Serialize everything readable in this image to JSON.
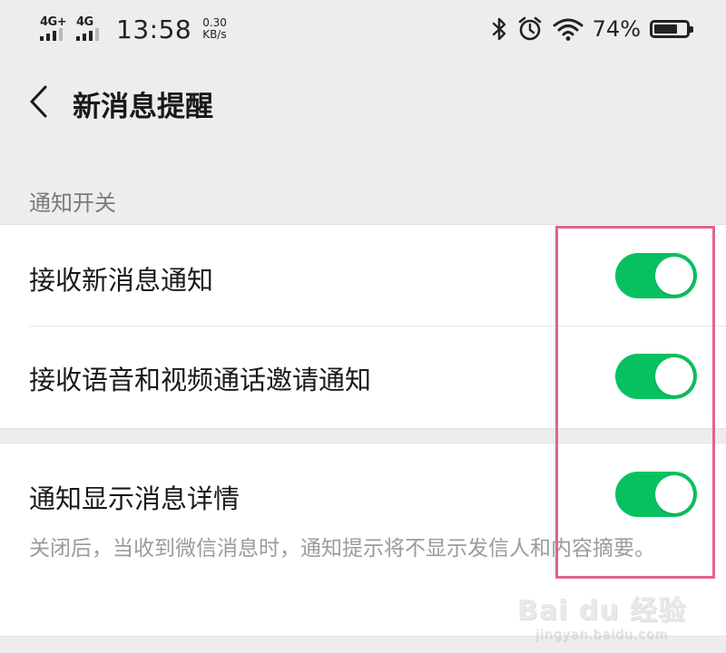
{
  "status_bar": {
    "network_1": "4G+",
    "network_2": "4G",
    "time": "13:58",
    "speed_value": "0.30",
    "speed_unit": "KB/s",
    "battery_percent_text": "74%",
    "battery_level": 0.74,
    "icons": [
      "bluetooth-icon",
      "alarm-icon",
      "wifi-icon",
      "battery-icon"
    ]
  },
  "nav": {
    "back_icon": "chevron-left-icon",
    "title": "新消息提醒"
  },
  "section": {
    "header": "通知开关"
  },
  "settings": [
    {
      "label": "接收新消息通知",
      "enabled": true
    },
    {
      "label": "接收语音和视频通话邀请通知",
      "enabled": true
    },
    {
      "label": "通知显示消息详情",
      "enabled": true,
      "description": "关闭后，当收到微信消息时，通知提示将不显示发信人和内容摘要。"
    }
  ],
  "watermark": {
    "logo": "Bai du 经验",
    "url": "jingyan.baidu.com"
  },
  "colors": {
    "background": "#ededed",
    "toggle_on": "#07c160",
    "highlight": "#e0648f"
  }
}
